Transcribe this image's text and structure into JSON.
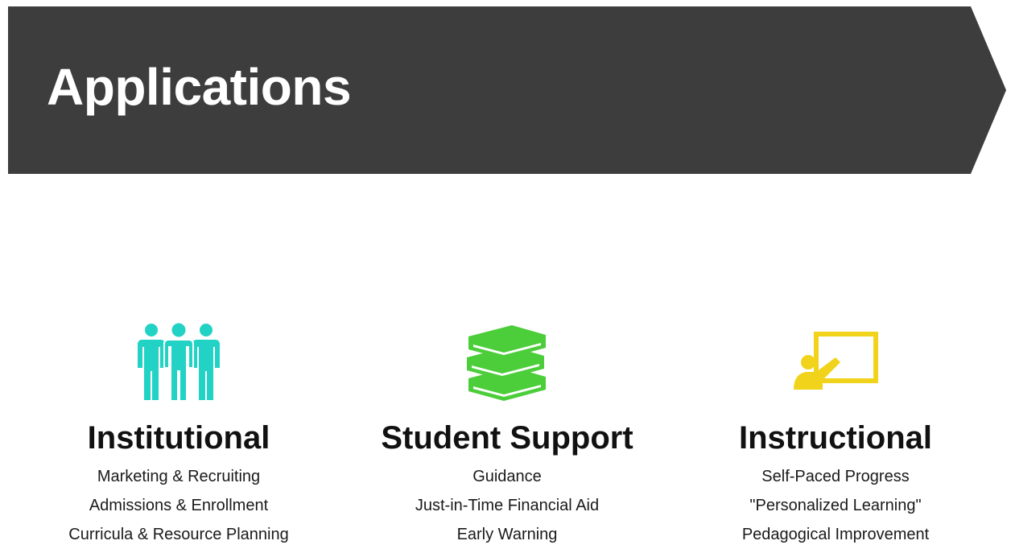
{
  "banner": {
    "title": "Applications",
    "color": "#3d3d3d"
  },
  "columns": [
    {
      "heading": "Institutional",
      "icon": "group-of-people-icon",
      "icon_color": "#22d3c5",
      "items": [
        "Marketing & Recruiting",
        "Admissions & Enrollment",
        "Curricula & Resource Planning"
      ]
    },
    {
      "heading": "Student Support",
      "icon": "stack-of-books-icon",
      "icon_color": "#4ccd3a",
      "items": [
        "Guidance",
        "Just-in-Time Financial Aid",
        "Early Warning"
      ]
    },
    {
      "heading": "Instructional",
      "icon": "teacher-at-board-icon",
      "icon_color": "#f2d31b",
      "items": [
        "Self-Paced Progress",
        "\"Personalized Learning\"",
        "Pedagogical Improvement"
      ]
    }
  ]
}
